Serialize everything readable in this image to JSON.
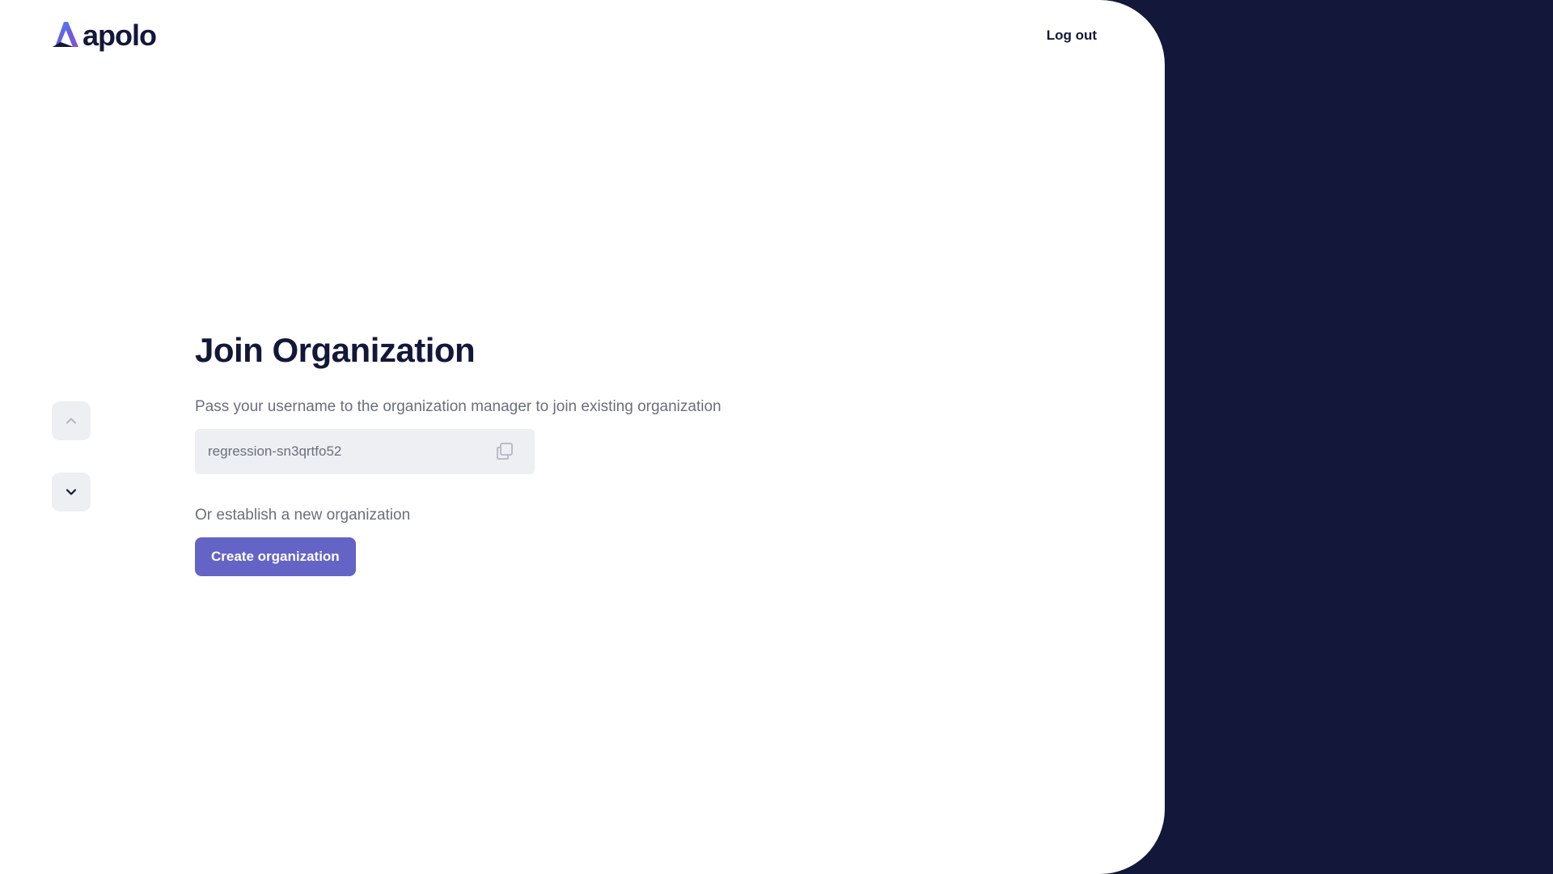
{
  "header": {
    "logo_text": "apolo",
    "logout_label": "Log out"
  },
  "nav": {
    "up_icon": "chevron-up-icon",
    "down_icon": "chevron-down-icon"
  },
  "main": {
    "title": "Join Organization",
    "description": "Pass your username to the organization manager to join existing organization",
    "username": "regression-sn3qrtfo52",
    "copy_icon": "copy-icon",
    "alternative_text": "Or establish a new organization",
    "create_button_label": "Create organization"
  },
  "colors": {
    "background_dark": "#13183a",
    "accent": "#6463c6",
    "field_background": "#eeeff2",
    "muted_text": "#6b6f7c"
  }
}
